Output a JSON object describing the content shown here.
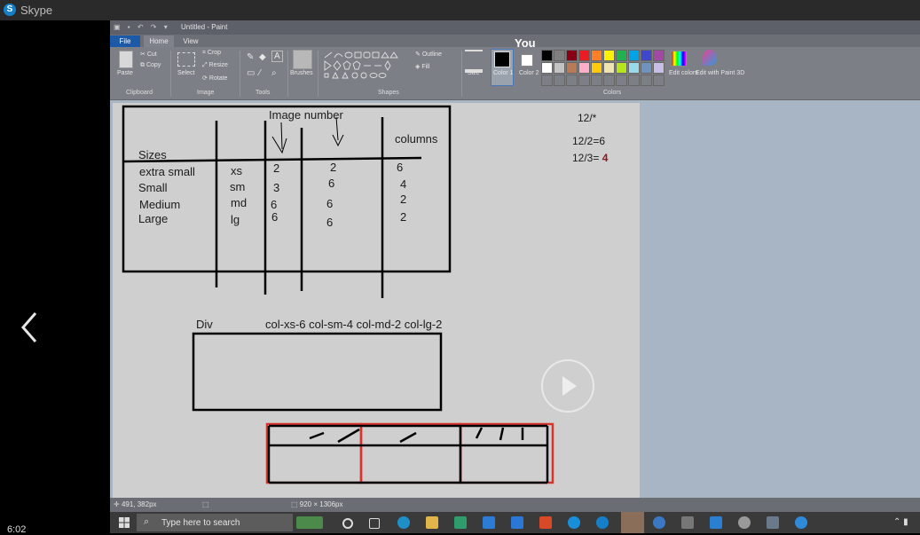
{
  "skype": {
    "title": "Skype",
    "logo_letter": "S",
    "clock": "6:02"
  },
  "paint": {
    "window_title": "Untitled - Paint",
    "tabs": [
      "File",
      "Home",
      "View"
    ],
    "clipboard": {
      "paste": "Paste",
      "cut": "Cut",
      "copy": "Copy",
      "group": "Clipboard"
    },
    "image": {
      "select": "Select",
      "crop": "Crop",
      "resize": "Resize",
      "rotate": "Rotate",
      "group": "Image"
    },
    "tools_group": "Tools",
    "brushes": "Brushes",
    "shapes": {
      "outline": "Outline",
      "fill": "Fill",
      "group": "Shapes"
    },
    "size": "Size",
    "color1": "Color 1",
    "color2": "Color 2",
    "colors_group": "Colors",
    "edit_colors": "Edit colors",
    "edit_3d": "Edit with Paint 3D",
    "palette": [
      "#000000",
      "#7f7f7f",
      "#880015",
      "#ed1c24",
      "#ff7f27",
      "#fff200",
      "#22b14c",
      "#00a2e8",
      "#3f48cc",
      "#a349a4",
      "#ffffff",
      "#c3c3c3",
      "#b97a57",
      "#ffaec9",
      "#ffc90e",
      "#efe4b0",
      "#b5e61d",
      "#99d9ea",
      "#7092be",
      "#c8bfe7"
    ],
    "status": {
      "cursor_pos": "491, 382px",
      "image_size": "920 × 1306px"
    }
  },
  "presenter_label": "You",
  "canvas": {
    "image_number": "Image number",
    "sizes": "Sizes",
    "columns": "columns",
    "rows": [
      {
        "name": "extra small",
        "abbr": "xs",
        "c1": "2",
        "c2": "2",
        "c3": "6"
      },
      {
        "name": "Small",
        "abbr": "sm",
        "c1": "3",
        "c2": "6",
        "c3": "4"
      },
      {
        "name": "Medium",
        "abbr": "md",
        "c1": "6",
        "c2": "6",
        "c3": "2"
      },
      {
        "name": "Large",
        "abbr": "lg",
        "c1": "6",
        "c2": "6",
        "c3": "2"
      }
    ],
    "notes": [
      "12/*",
      "12/2=6",
      "12/3= "
    ],
    "note_highlight": "4",
    "div_label": "Div",
    "class_text": "col-xs-6 col-sm-4 col-md-2 col-lg-2"
  },
  "taskbar": {
    "search_placeholder": "Type here to search"
  }
}
